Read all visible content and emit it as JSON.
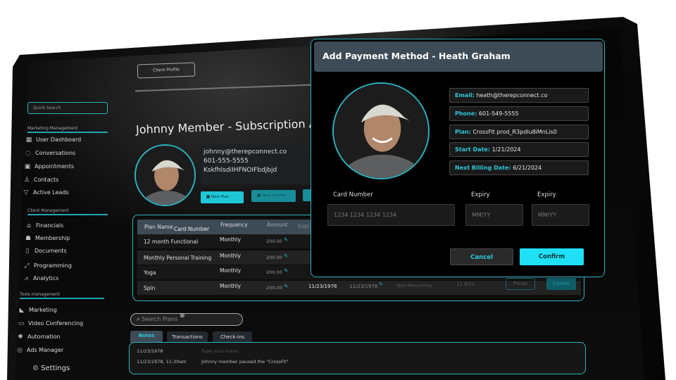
{
  "sidebar": {
    "search_placeholder": "Quick Search",
    "sections": [
      {
        "title": "Marketing Management",
        "items": [
          {
            "label": "User Dashboard",
            "icon": "dashboard-icon"
          },
          {
            "label": "Conversations",
            "icon": "chat-icon"
          },
          {
            "label": "Appointments",
            "icon": "calendar-icon"
          },
          {
            "label": "Contacts",
            "icon": "contact-icon"
          },
          {
            "label": "Active Leads",
            "icon": "funnel-icon"
          }
        ]
      },
      {
        "title": "Client Management",
        "items": [
          {
            "label": "Financials",
            "icon": "bank-icon"
          },
          {
            "label": "Membership",
            "icon": "group-icon"
          },
          {
            "label": "Documents",
            "icon": "document-icon"
          },
          {
            "label": "Programming",
            "icon": "dumbbell-icon"
          },
          {
            "label": "Analytics",
            "icon": "chart-icon"
          }
        ]
      },
      {
        "title": "Tools management",
        "items": [
          {
            "label": "Marketing",
            "icon": "megaphone-icon"
          },
          {
            "label": "Video Conferencing",
            "icon": "video-icon"
          },
          {
            "label": "Automation",
            "icon": "automation-icon"
          },
          {
            "label": "Ads Manager",
            "icon": "target-icon"
          }
        ]
      }
    ],
    "settings": "Settings"
  },
  "main": {
    "breadcrumb": "Client Profile",
    "title": "Johnny Member - Subscription Acc",
    "client": {
      "email": "johnny@therepconnect.co",
      "phone": "601-555-5555",
      "id": "KskfhlsdiIHFNOIFbdjbjd"
    },
    "buttons": {
      "new_plan": "New Plan",
      "second": "New Invoice"
    },
    "table": {
      "headers": [
        "Plan Name",
        "Card Number",
        "Frequency",
        "Amount",
        "Expi"
      ],
      "rows": [
        [
          "12 month Functional",
          "Monthly",
          "200.00"
        ],
        [
          "Monthly Personal Training",
          "Monthly",
          "200.00"
        ],
        [
          "Yoga",
          "Monthly",
          "200.00"
        ],
        [
          "Spin",
          "Monthly",
          "200.00"
        ]
      ],
      "spin_extra": {
        "start": "11/23/1978",
        "end": "11/23/1978",
        "type": "Non-Recurring",
        "bills": "12 Bills",
        "pause": "Pause",
        "cancel": "Cancel"
      }
    },
    "search_placeholder": "Search Plans",
    "tabs": [
      "Notes",
      "Transactions",
      "Check-ins"
    ],
    "notes": [
      {
        "date": "11/23/1978",
        "text": "Type your notes"
      },
      {
        "date": "11/23/1978, 11:30am",
        "text": "Johnny member paused the \"CrossFit\""
      }
    ]
  },
  "modal": {
    "title": "Add Payment Method - Heath Graham",
    "fields": [
      {
        "label": "Email:",
        "value": "heath@therepconnect.co"
      },
      {
        "label": "Phone:",
        "value": "601-549-5555"
      },
      {
        "label": "Plan:",
        "value": "CrossFit prod_R3pdlu8iMnLis0"
      },
      {
        "label": "Start Date:",
        "value": "1/21/2024"
      },
      {
        "label": "Next Billing Date:",
        "value": "6/21/2024"
      }
    ],
    "card_label": "Card Number",
    "card_placeholder": "1234  1234  1234  1234",
    "expiry_label": "Expiry",
    "expiry_placeholder": "MM/YY",
    "expiry2_label": "Expiry",
    "expiry2_placeholder": "MM/YY",
    "cancel": "Cancel",
    "confirm": "Confirm"
  },
  "colors": {
    "accent": "#1fe0f5",
    "border": "#2bb3c0"
  }
}
